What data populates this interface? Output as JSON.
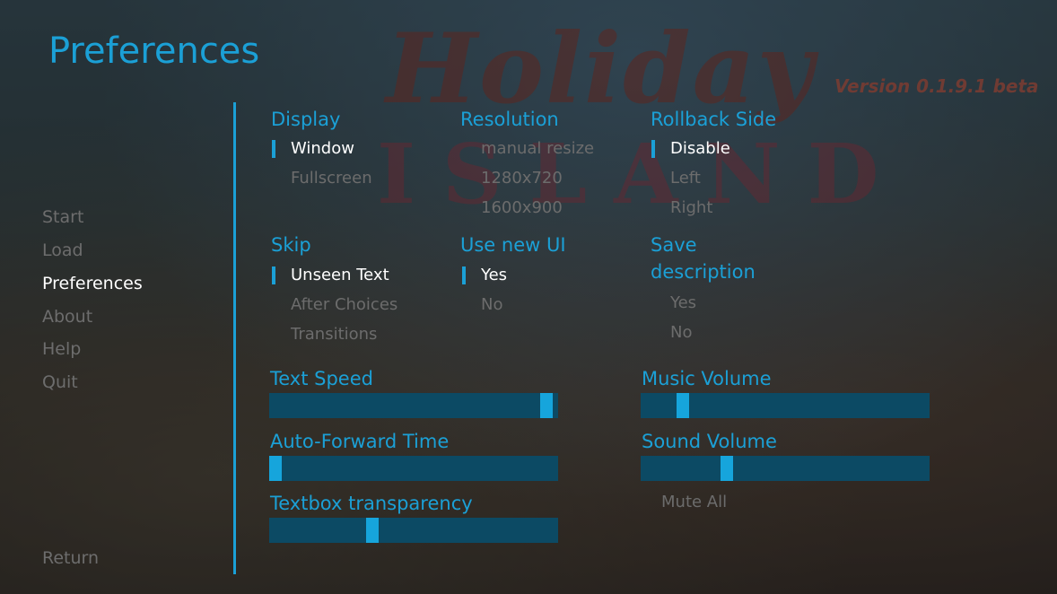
{
  "logo": {
    "line1": "Holiday",
    "line2": "ISLAND"
  },
  "version": "Version 0.1.9.1 beta",
  "title": "Preferences",
  "nav": [
    {
      "label": "Start"
    },
    {
      "label": "Load"
    },
    {
      "label": "Preferences",
      "active": true
    },
    {
      "label": "About"
    },
    {
      "label": "Help"
    },
    {
      "label": "Quit"
    }
  ],
  "return_label": "Return",
  "display": {
    "title": "Display",
    "options": [
      "Window",
      "Fullscreen"
    ],
    "selected": "Window"
  },
  "resolution": {
    "title": "Resolution",
    "options": [
      "manual resize",
      "1280x720",
      "1600x900"
    ]
  },
  "rollback": {
    "title": "Rollback Side",
    "options": [
      "Disable",
      "Left",
      "Right"
    ],
    "selected": "Disable"
  },
  "skip": {
    "title": "Skip",
    "options": [
      "Unseen Text",
      "After Choices",
      "Transitions"
    ],
    "selected": "Unseen Text"
  },
  "new_ui": {
    "title": "Use new UI",
    "options": [
      "Yes",
      "No"
    ],
    "selected": "Yes"
  },
  "save_desc": {
    "title_line1": "Save",
    "title_line2": "description",
    "options": [
      "Yes",
      "No"
    ]
  },
  "sliders": {
    "text_speed": {
      "label": "Text Speed",
      "value": 0.98
    },
    "auto_forward": {
      "label": "Auto-Forward Time",
      "value": 0.0
    },
    "textbox_transparency": {
      "label": "Textbox transparency",
      "value": 0.35
    },
    "music_volume": {
      "label": "Music Volume",
      "value": 0.13
    },
    "sound_volume": {
      "label": "Sound Volume",
      "value": 0.29
    }
  },
  "mute_all": "Mute All",
  "colors": {
    "accent": "#1ba0d6",
    "slider_track": "#0c4a64",
    "selected_text": "#ffffff",
    "idle_text": "#6c6c6c"
  }
}
